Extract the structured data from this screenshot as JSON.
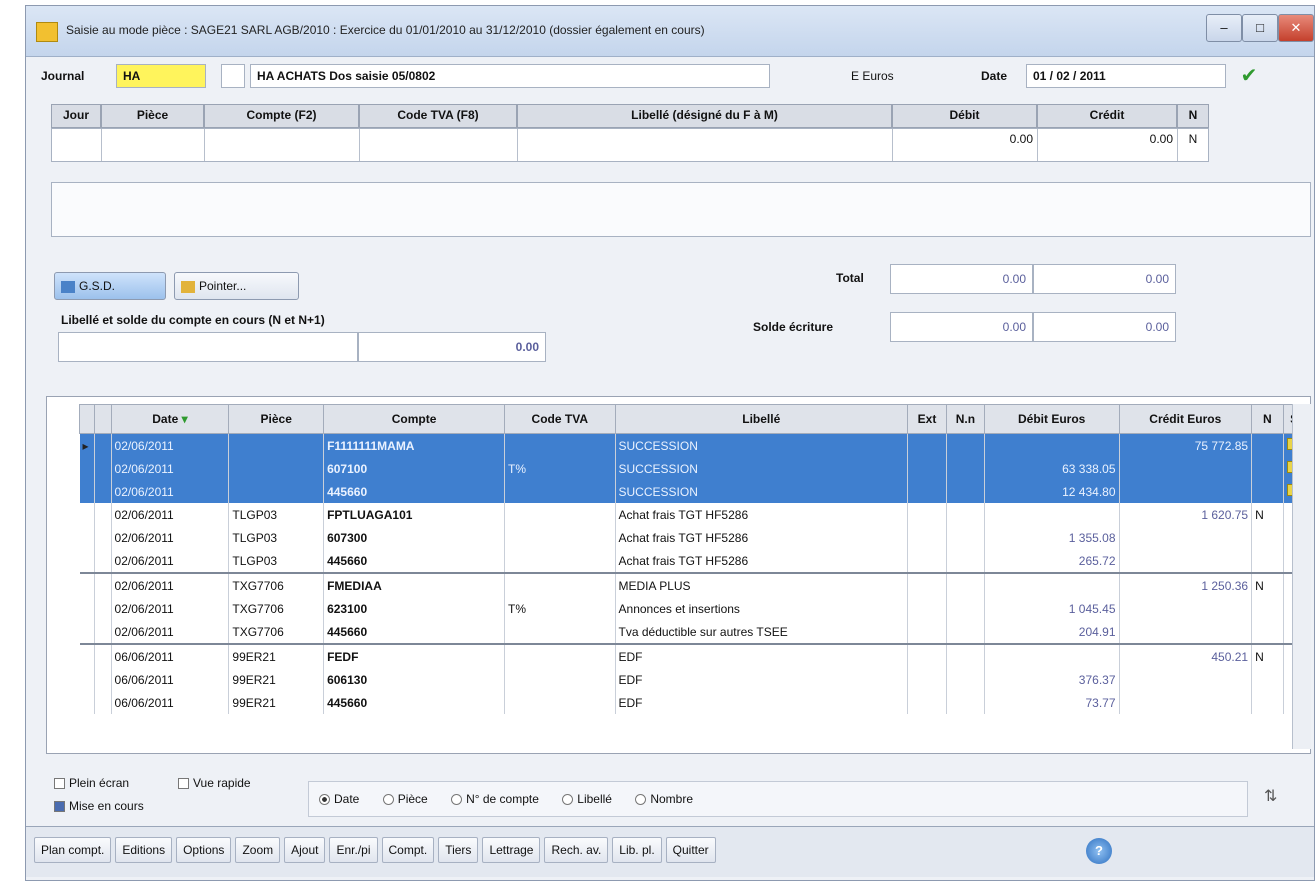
{
  "window": {
    "title": "Saisie au mode pièce : SAGE21 SARL AGB/2010 : Exercice du 01/01/2010 au 31/12/2010 (dossier également en cours)",
    "minimize": "–",
    "maximize": "□",
    "close": "✕"
  },
  "header": {
    "journal_label": "Journal",
    "journal_value": "HA",
    "journal_desc": "HA   ACHATS  Dos  saisie  05/0802",
    "currency": "E  Euros",
    "date_label": "Date",
    "date_value": "01 / 02 / 2011",
    "validate_icon": "checkmark-icon"
  },
  "entry_grid": {
    "columns": [
      "Jour",
      "Pièce",
      "Compte (F2)",
      "Code TVA (F8)",
      "Libellé (désigné du F à M)",
      "Débit",
      "Crédit",
      "N"
    ],
    "row": {
      "jour": "",
      "piece": "",
      "compte": "",
      "tva": "",
      "libelle": "",
      "debit": "0.00",
      "credit": "0.00",
      "n": "N"
    }
  },
  "buttons": {
    "gsd": "G.S.D.",
    "pointer": "Pointer..."
  },
  "totals": {
    "total_label": "Total",
    "total_debit": "0.00",
    "total_credit": "0.00",
    "solde_label": "Solde écriture",
    "solde_debit": "0.00",
    "solde_credit": "0.00"
  },
  "account_balance": {
    "label": "Libellé et solde du compte en cours (N et N+1)",
    "value": "0.00"
  },
  "ledger": {
    "columns": [
      "",
      "",
      "Date",
      "Pièce",
      "Compte",
      "Code TVA",
      "Libellé",
      "Ext",
      "N.n",
      "Débit Euros",
      "Crédit Euros",
      "N",
      "S."
    ],
    "rows": [
      {
        "date": "02/06/2011",
        "piece": "",
        "compte": "F1111111MAMA",
        "tva": "",
        "libelle": "SUCCESSION",
        "debit": "",
        "credit": "75 772.85",
        "n": "",
        "selected": true,
        "sep": false
      },
      {
        "date": "02/06/2011",
        "piece": "",
        "compte": "607100",
        "tva": "T%",
        "libelle": "SUCCESSION",
        "debit": "63 338.05",
        "credit": "",
        "n": "",
        "selected": true,
        "sep": false
      },
      {
        "date": "02/06/2011",
        "piece": "",
        "compte": "445660",
        "tva": "",
        "libelle": "SUCCESSION",
        "debit": "12 434.80",
        "credit": "",
        "n": "",
        "selected": true,
        "sep": false
      },
      {
        "date": "02/06/2011",
        "piece": "TLGP03",
        "compte": "FPTLUAGA101",
        "tva": "",
        "libelle": "Achat frais TGT HF5286",
        "debit": "",
        "credit": "1 620.75",
        "n": "N",
        "selected": false,
        "sep": false
      },
      {
        "date": "02/06/2011",
        "piece": "TLGP03",
        "compte": "607300",
        "tva": "",
        "libelle": "Achat frais TGT HF5286",
        "debit": "1 355.08",
        "credit": "",
        "n": "",
        "selected": false,
        "sep": false
      },
      {
        "date": "02/06/2011",
        "piece": "TLGP03",
        "compte": "445660",
        "tva": "",
        "libelle": "Achat frais TGT HF5286",
        "debit": "265.72",
        "credit": "",
        "n": "",
        "selected": false,
        "sep": false
      },
      {
        "date": "02/06/2011",
        "piece": "TXG7706",
        "compte": "FMEDIAA",
        "tva": "",
        "libelle": "MEDIA PLUS",
        "debit": "",
        "credit": "1 250.36",
        "n": "N",
        "selected": false,
        "sep": true
      },
      {
        "date": "02/06/2011",
        "piece": "TXG7706",
        "compte": "623100",
        "tva": "T%",
        "libelle": "Annonces et insertions",
        "debit": "1 045.45",
        "credit": "",
        "n": "",
        "selected": false,
        "sep": false
      },
      {
        "date": "02/06/2011",
        "piece": "TXG7706",
        "compte": "445660",
        "tva": "",
        "libelle": "Tva déductible sur autres TSEE",
        "debit": "204.91",
        "credit": "",
        "n": "",
        "selected": false,
        "sep": false
      },
      {
        "date": "06/06/2011",
        "piece": "99ER21",
        "compte": "FEDF",
        "tva": "",
        "libelle": "EDF",
        "debit": "",
        "credit": "450.21",
        "n": "N",
        "selected": false,
        "sep": true
      },
      {
        "date": "06/06/2011",
        "piece": "99ER21",
        "compte": "606130",
        "tva": "",
        "libelle": "EDF",
        "debit": "376.37",
        "credit": "",
        "n": "",
        "selected": false,
        "sep": false
      },
      {
        "date": "06/06/2011",
        "piece": "99ER21",
        "compte": "445660",
        "tva": "",
        "libelle": "EDF",
        "debit": "73.77",
        "credit": "",
        "n": "",
        "selected": false,
        "sep": false
      }
    ]
  },
  "filters": {
    "plein_ecran": "Plein écran",
    "vue_rapide": "Vue rapide",
    "mise_en_cours": "Mise en cours",
    "sort_options": [
      "Date",
      "Pièce",
      "N° de compte",
      "Libellé",
      "Nombre"
    ]
  },
  "toolbar": {
    "items": [
      "Plan compt.",
      "Editions",
      "Options",
      "Zoom",
      "Ajout",
      "Enr./pi",
      "Compt.",
      "Tiers",
      "Lettrage",
      "Rech. av.",
      "Lib. pl.",
      "Quitter"
    ]
  }
}
